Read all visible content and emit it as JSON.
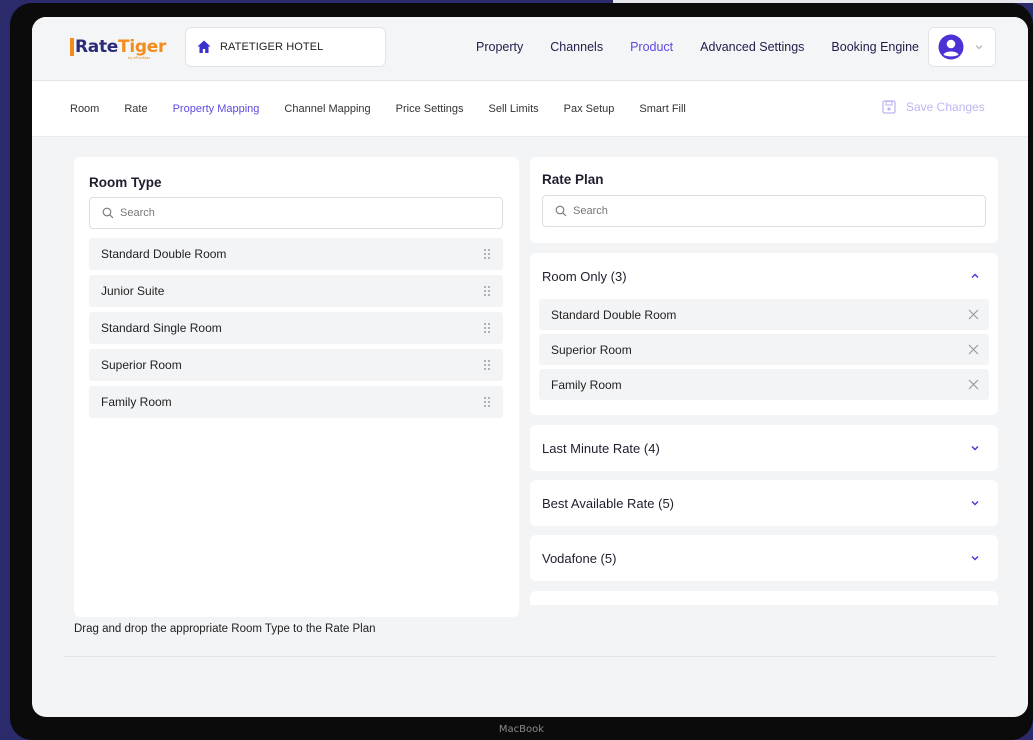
{
  "app": {
    "logo_main": "Rate",
    "logo_accent": "Tiger",
    "logo_sub": "by eRevMax"
  },
  "hotel": {
    "name": "RATETIGER HOTEL"
  },
  "main_nav": [
    {
      "label": "Property",
      "active": false
    },
    {
      "label": "Channels",
      "active": false
    },
    {
      "label": "Product",
      "active": true
    },
    {
      "label": "Advanced Settings",
      "active": false
    },
    {
      "label": "Booking Engine",
      "active": false
    }
  ],
  "sub_nav": [
    {
      "label": "Room",
      "active": false
    },
    {
      "label": "Rate",
      "active": false
    },
    {
      "label": "Property Mapping",
      "active": true
    },
    {
      "label": "Channel Mapping",
      "active": false
    },
    {
      "label": "Price Settings",
      "active": false
    },
    {
      "label": "Sell Limits",
      "active": false
    },
    {
      "label": "Pax Setup",
      "active": false
    },
    {
      "label": "Smart Fill",
      "active": false
    }
  ],
  "save_label": "Save Changes",
  "room_type": {
    "title": "Room Type",
    "search_placeholder": "Search",
    "items": [
      "Standard Double Room",
      "Junior Suite",
      "Standard Single Room",
      "Superior Room",
      "Family Room"
    ]
  },
  "rate_plan": {
    "title": "Rate Plan",
    "search_placeholder": "Search",
    "groups": [
      {
        "label": "Room Only (3)",
        "expanded": true,
        "rooms": [
          "Standard Double Room",
          "Superior Room",
          "Family Room"
        ]
      },
      {
        "label": "Last Minute Rate (4)",
        "expanded": false
      },
      {
        "label": "Best Available Rate (5)",
        "expanded": false
      },
      {
        "label": "Vodafone (5)",
        "expanded": false
      }
    ]
  },
  "hint": "Drag and drop the appropriate Room Type to the Rate Plan",
  "device_label": "MacBook",
  "colors": {
    "accent": "#5b4be3",
    "brand_orange": "#f28c1c",
    "brand_navy": "#2b2b7a"
  }
}
